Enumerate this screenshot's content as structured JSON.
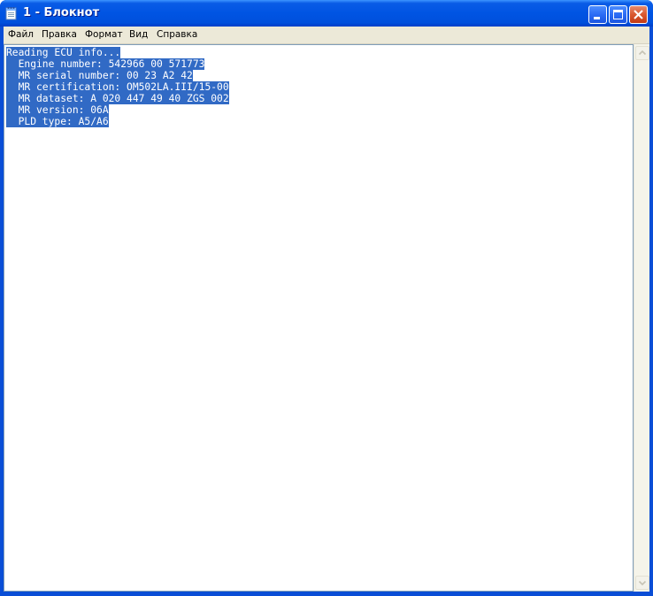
{
  "window": {
    "title": "1 - Блокнот",
    "app_icon": "notepad-icon"
  },
  "controls": {
    "minimize_icon": "minimize-icon",
    "maximize_icon": "maximize-icon",
    "close_icon": "close-icon"
  },
  "menu": {
    "file": "Файл",
    "edit": "Правка",
    "format": "Формат",
    "view": "Вид",
    "help": "Справка"
  },
  "document": {
    "lines": [
      "Reading ECU info...",
      "  Engine number: 542966 00 571773",
      "  MR serial number: 00 23 A2 42",
      "  MR certification: OM502LA.III/15-00",
      "  MR dataset: A 020 447 49 40 ZGS 002",
      "  MR version: 06A",
      "  PLD type: A5/A6"
    ],
    "selection_color": "#316ac5"
  },
  "scrollbar": {
    "up_icon": "scroll-up-arrow-icon",
    "down_icon": "scroll-down-arrow-icon"
  },
  "colors": {
    "titlebar": "#0054e3",
    "menubar": "#ece9d8",
    "selection": "#316ac5"
  }
}
